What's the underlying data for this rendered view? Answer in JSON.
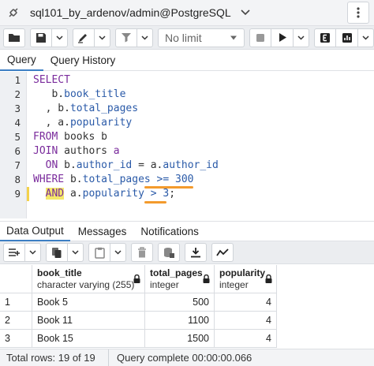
{
  "connection": {
    "title": "sql101_by_ardenov/admin@PostgreSQL"
  },
  "toolbar": {
    "limit_value": "No limit"
  },
  "editor_tabs": [
    {
      "label": "Query"
    },
    {
      "label": "Query History"
    }
  ],
  "editor": {
    "line_numbers": [
      "1",
      "2",
      "3",
      "4",
      "5",
      "6",
      "7",
      "8",
      "9"
    ],
    "lines": {
      "l1": {
        "kw": "SELECT"
      },
      "l2": {
        "pre": "   b.",
        "col": "book_title"
      },
      "l3": {
        "pre": "  , b.",
        "col": "total_pages"
      },
      "l4": {
        "pre": "  , a.",
        "col": "popularity"
      },
      "l5": {
        "kw": "FROM",
        "rest": " books b"
      },
      "l6": {
        "kw": "JOIN",
        "rest": " authors ",
        "alias": "a"
      },
      "l7": {
        "kw": "ON",
        "a1": " b.",
        "c1": "author_id",
        "eq": " = ",
        "a2": "a.",
        "c2": "author_id"
      },
      "l8": {
        "kw": "WHERE",
        "a1": " b.",
        "c1": "total_pages",
        "op": " >= ",
        "val": "300"
      },
      "l9": {
        "kw": "AND",
        "a1": " a.",
        "c1": "popularity",
        "op": " > ",
        "val": "3",
        "end": ";"
      }
    }
  },
  "results_tabs": [
    {
      "label": "Data Output"
    },
    {
      "label": "Messages"
    },
    {
      "label": "Notifications"
    }
  ],
  "grid": {
    "columns": [
      {
        "name": "book_title",
        "type": "character varying (255)"
      },
      {
        "name": "total_pages",
        "type": "integer"
      },
      {
        "name": "popularity",
        "type": "integer"
      }
    ],
    "rows": [
      {
        "n": "1",
        "book_title": "Book 5",
        "total_pages": "500",
        "popularity": "4"
      },
      {
        "n": "2",
        "book_title": "Book 11",
        "total_pages": "1100",
        "popularity": "4"
      },
      {
        "n": "3",
        "book_title": "Book 15",
        "total_pages": "1500",
        "popularity": "4"
      }
    ]
  },
  "status": {
    "rows": "Total rows: 19 of 19",
    "query": "Query complete 00:00:00.066"
  },
  "colors": {
    "keyword": "#7a2b9c",
    "identifier": "#2a5aa8",
    "highlight": "#f5e86a",
    "underline": "#f39b2d",
    "tab_accent": "#3d7fc4"
  }
}
